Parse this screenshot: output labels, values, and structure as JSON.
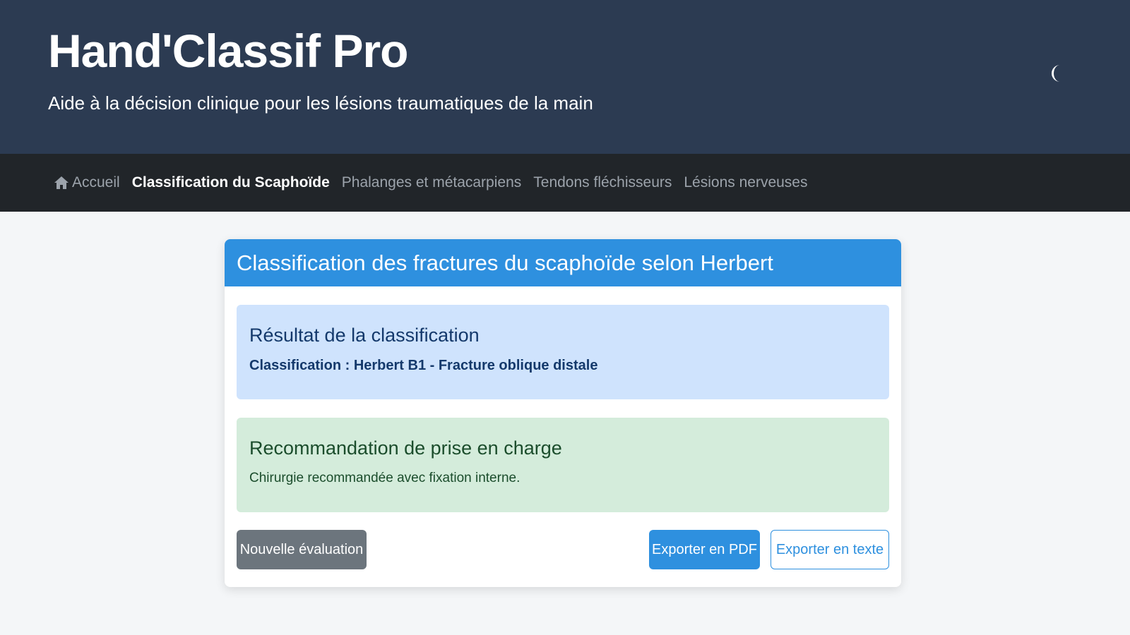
{
  "header": {
    "title": "Hand'Classif Pro",
    "subtitle": "Aide à la décision clinique pour les lésions traumatiques de la main",
    "theme_toggle_icon": "moon-icon"
  },
  "nav": {
    "items": [
      {
        "label": "Accueil",
        "icon": "home-icon",
        "active": false
      },
      {
        "label": "Classification du Scaphoïde",
        "active": true
      },
      {
        "label": "Phalanges et métacarpiens",
        "active": false
      },
      {
        "label": "Tendons fléchisseurs",
        "active": false
      },
      {
        "label": "Lésions nerveuses",
        "active": false
      }
    ]
  },
  "card": {
    "title": "Classification des fractures du scaphoïde selon Herbert",
    "result": {
      "title": "Résultat de la classification",
      "text": "Classification : Herbert B1 - Fracture oblique distale"
    },
    "recommendation": {
      "title": "Recommandation de prise en charge",
      "text": "Chirurgie recommandée avec fixation interne."
    },
    "buttons": {
      "new_evaluation": "Nouvelle évaluation",
      "export_pdf": "Exporter en PDF",
      "export_text": "Exporter en texte"
    }
  },
  "colors": {
    "header_bg": "#2c3b52",
    "navbar_bg": "#212529",
    "primary": "#2e90df",
    "result_bg": "#cfe3fd",
    "reco_bg": "#d4ecdb",
    "secondary_button": "#6c757d"
  }
}
